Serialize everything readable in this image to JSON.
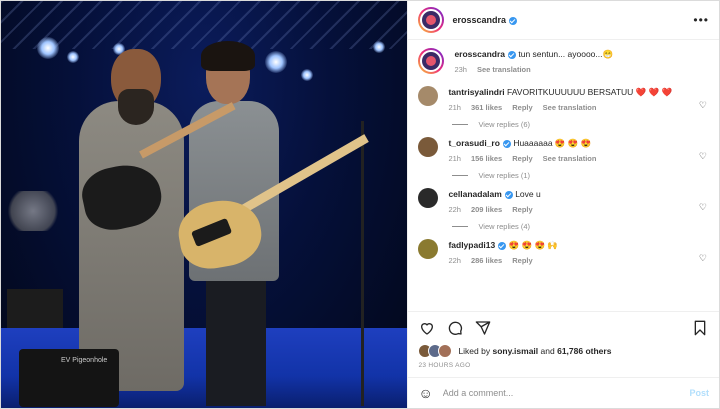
{
  "post": {
    "author": "erosscandra",
    "caption_user": "erosscandra",
    "caption_text": "tun sentun... ayoooo...😁",
    "caption_time": "23h",
    "see_translation": "See translation",
    "photo_amp_label": "EV Pigeonhole"
  },
  "comments": [
    {
      "user": "tantrisyalindri",
      "text": "FAVORITKUUUUUU BERSATUU ❤️ ❤️ ❤️",
      "time": "21h",
      "likes": "361 likes",
      "reply": "Reply",
      "translate": "See translation",
      "replies": "View replies (6)",
      "avatar_color": "#a58a6a"
    },
    {
      "user": "t_orasudi_ro",
      "text": "Huaaaaaa 😍 😍 😍",
      "time": "21h",
      "likes": "156 likes",
      "reply": "Reply",
      "translate": "See translation",
      "replies": "View replies (1)",
      "avatar_color": "#7a5a3a"
    },
    {
      "user": "cellanadalam",
      "text": "Love u",
      "time": "22h",
      "likes": "209 likes",
      "reply": "Reply",
      "translate": "",
      "replies": "View replies (4)",
      "avatar_color": "#2a2a2a"
    },
    {
      "user": "fadlypadi13",
      "text": "😍 😍 😍 🙌",
      "time": "22h",
      "likes": "286 likes",
      "reply": "Reply",
      "translate": "",
      "replies": "",
      "avatar_color": "#8a7a30"
    }
  ],
  "likes": {
    "prefix": "Liked by",
    "user": "sony.ismail",
    "middle": "and",
    "count": "61,786 others"
  },
  "time_ago": "23 HOURS AGO",
  "add_comment": {
    "placeholder": "Add a comment...",
    "post": "Post"
  },
  "icons": {
    "more": "more-icon",
    "heart": "heart-icon",
    "comment": "comment-icon",
    "share": "share-icon",
    "save": "bookmark-icon",
    "emoji": "emoji-icon"
  },
  "colors": {
    "verified": "#3897f0",
    "post_button": "#b2dffc",
    "meta_text": "#8e8e8e"
  }
}
